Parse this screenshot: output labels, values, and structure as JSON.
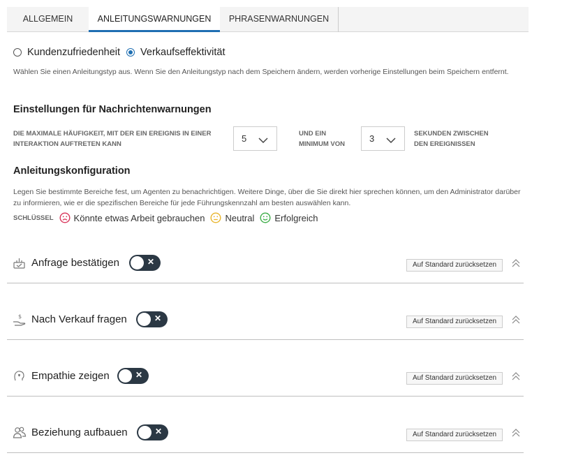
{
  "tabs": [
    {
      "label": "ALLGEMEIN"
    },
    {
      "label": "ANLEITUNGSWARNUNGEN"
    },
    {
      "label": "PHRASENWARNUNGEN"
    }
  ],
  "guidance_type": {
    "options": [
      {
        "label": "Kundenzufriedenheit",
        "selected": false
      },
      {
        "label": "Verkaufseffektivität",
        "selected": true
      }
    ],
    "description": "Wählen Sie einen Anleitungstyp aus. Wenn Sie den Anleitungstyp nach dem Speichern ändern, werden vorherige Einstellungen beim Speichern entfernt."
  },
  "message_warnings": {
    "title": "Einstellungen für Nachrichtenwarnungen",
    "max_frequency_label": "DIE MAXIMALE HÄUFIGKEIT, MIT DER EIN EREIGNIS IN EINER INTERAKTION AUFTRETEN KANN",
    "max_frequency_value": "5",
    "minimum_label": "UND EIN MINIMUM VON",
    "minimum_value": "3",
    "seconds_label": "SEKUNDEN ZWISCHEN DEN EREIGNISSEN"
  },
  "guidance_config": {
    "title": "Anleitungskonfiguration",
    "description": "Legen Sie bestimmte Bereiche fest, um Agenten zu benachrichtigen. Weitere Dinge, über die Sie direkt hier sprechen können, um den Administrator darüber zu informieren, wie er die spezifischen Bereiche für jede Führungskennzahl am besten auswählen kann.",
    "key_label": "SCHLÜSSEL",
    "key_items": [
      {
        "label": "Könnte etwas Arbeit gebrauchen",
        "icon": "sad-face-icon",
        "color": "#d9365b"
      },
      {
        "label": "Neutral",
        "icon": "neutral-face-icon",
        "color": "#e9b52c"
      },
      {
        "label": "Erfolgreich",
        "icon": "happy-face-icon",
        "color": "#3fae49"
      }
    ]
  },
  "sections": [
    {
      "title": "Anfrage bestätigen",
      "icon": "confirm-request-icon",
      "enabled": false,
      "reset_label": "Auf Standard zurücksetzen"
    },
    {
      "title": "Nach Verkauf fragen",
      "icon": "money-hand-icon",
      "enabled": false,
      "reset_label": "Auf Standard zurücksetzen"
    },
    {
      "title": "Empathie zeigen",
      "icon": "heart-head-icon",
      "enabled": false,
      "reset_label": "Auf Standard zurücksetzen"
    },
    {
      "title": "Beziehung aufbauen",
      "icon": "people-icon",
      "enabled": false,
      "reset_label": "Auf Standard zurücksetzen"
    }
  ],
  "colors": {
    "accent": "#1f6fb2",
    "toggle_off": "#2b3844"
  }
}
